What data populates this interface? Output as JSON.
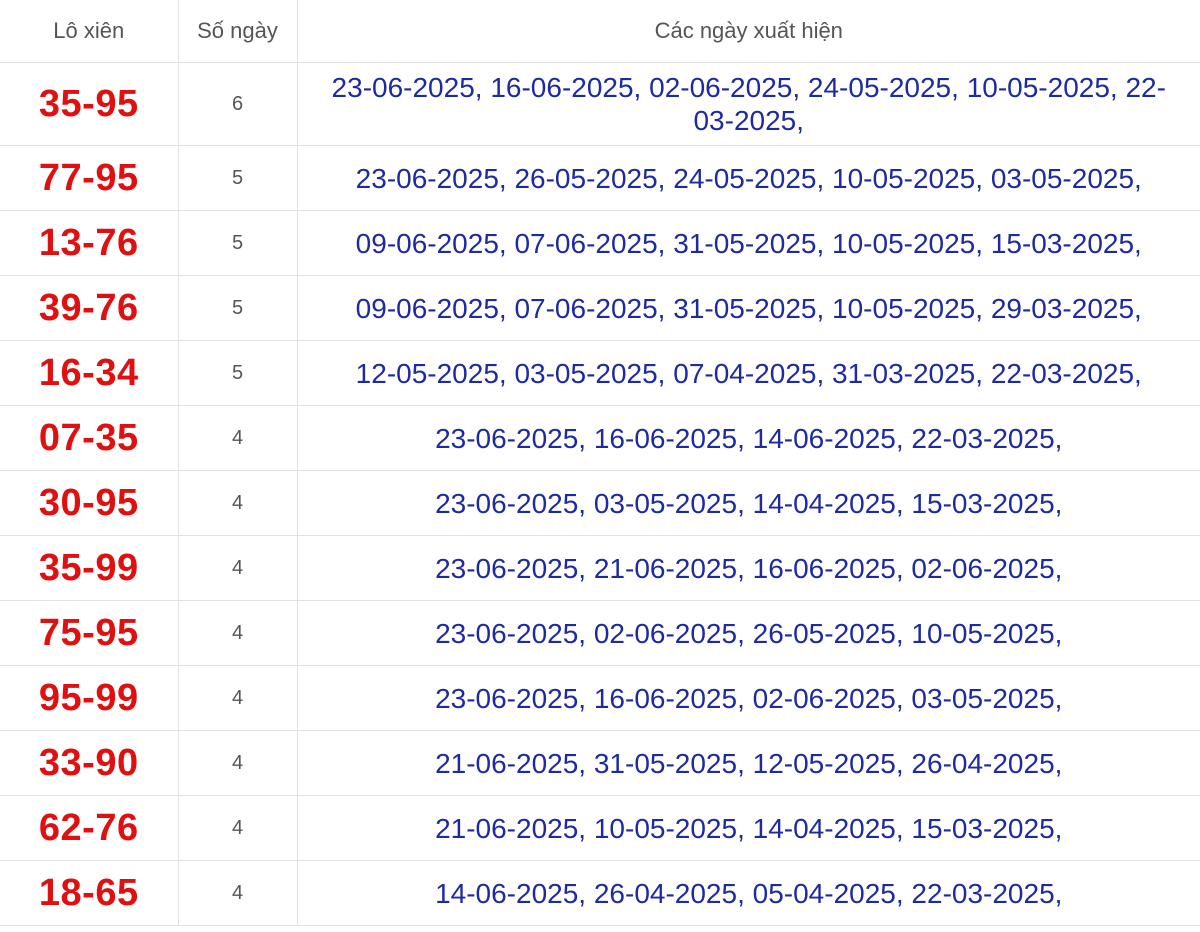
{
  "header": {
    "col_pair": "Lô xiên",
    "col_count": "Số ngày",
    "col_dates": "Các ngày xuất hiện"
  },
  "accent_color": "#d3212d",
  "pair_color": "#e01010",
  "date_color": "#1e2aa0",
  "rows": [
    {
      "pair": "35-95",
      "count": "6",
      "dates": "23-06-2025, 16-06-2025, 02-06-2025, 24-05-2025, 10-05-2025, 22-03-2025,"
    },
    {
      "pair": "77-95",
      "count": "5",
      "dates": "23-06-2025, 26-05-2025, 24-05-2025, 10-05-2025, 03-05-2025,"
    },
    {
      "pair": "13-76",
      "count": "5",
      "dates": "09-06-2025, 07-06-2025, 31-05-2025, 10-05-2025, 15-03-2025,"
    },
    {
      "pair": "39-76",
      "count": "5",
      "dates": "09-06-2025, 07-06-2025, 31-05-2025, 10-05-2025, 29-03-2025,"
    },
    {
      "pair": "16-34",
      "count": "5",
      "dates": "12-05-2025, 03-05-2025, 07-04-2025, 31-03-2025, 22-03-2025,"
    },
    {
      "pair": "07-35",
      "count": "4",
      "dates": "23-06-2025, 16-06-2025, 14-06-2025, 22-03-2025,"
    },
    {
      "pair": "30-95",
      "count": "4",
      "dates": "23-06-2025, 03-05-2025, 14-04-2025, 15-03-2025,"
    },
    {
      "pair": "35-99",
      "count": "4",
      "dates": "23-06-2025, 21-06-2025, 16-06-2025, 02-06-2025,"
    },
    {
      "pair": "75-95",
      "count": "4",
      "dates": "23-06-2025, 02-06-2025, 26-05-2025, 10-05-2025,"
    },
    {
      "pair": "95-99",
      "count": "4",
      "dates": "23-06-2025, 16-06-2025, 02-06-2025, 03-05-2025,"
    },
    {
      "pair": "33-90",
      "count": "4",
      "dates": "21-06-2025, 31-05-2025, 12-05-2025, 26-04-2025,"
    },
    {
      "pair": "62-76",
      "count": "4",
      "dates": "21-06-2025, 10-05-2025, 14-04-2025, 15-03-2025,"
    },
    {
      "pair": "18-65",
      "count": "4",
      "dates": "14-06-2025, 26-04-2025, 05-04-2025, 22-03-2025,"
    }
  ]
}
